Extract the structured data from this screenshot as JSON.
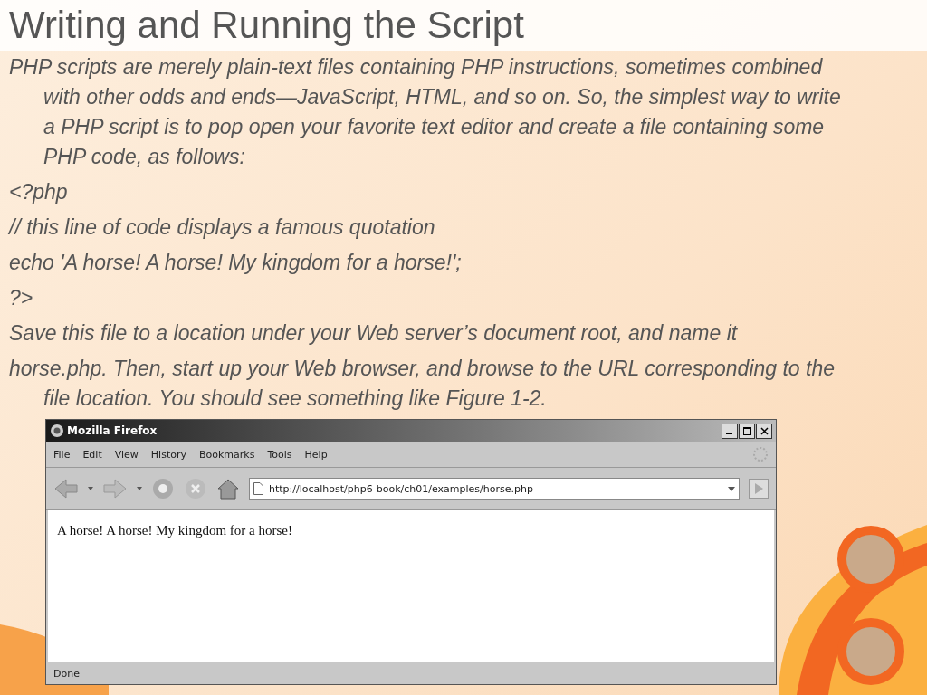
{
  "slide": {
    "title": "Writing and Running the Script",
    "paragraphs": [
      "PHP scripts are merely plain-text files containing PHP instructions, sometimes combined with other odds and ends—JavaScript, HTML, and so on. So, the simplest way to write a PHP script is to pop open your favorite text editor and create a file containing some PHP code, as follows:",
      "<?php",
      "// this line of code displays a famous quotation",
      "echo 'A horse! A horse! My kingdom for a horse!';",
      "?>",
      "Save this file to a location under your Web server’s document root, and name it",
      "horse.php. Then, start up your Web browser, and browse to the URL corresponding to  the file location. You should see something like Figure 1-2."
    ]
  },
  "browser": {
    "title": "Mozilla Firefox",
    "menu": [
      "File",
      "Edit",
      "View",
      "History",
      "Bookmarks",
      "Tools",
      "Help"
    ],
    "address": "http://localhost/php6-book/ch01/examples/horse.php",
    "content": "A horse! A horse! My kingdom for a horse!",
    "status": "Done"
  }
}
